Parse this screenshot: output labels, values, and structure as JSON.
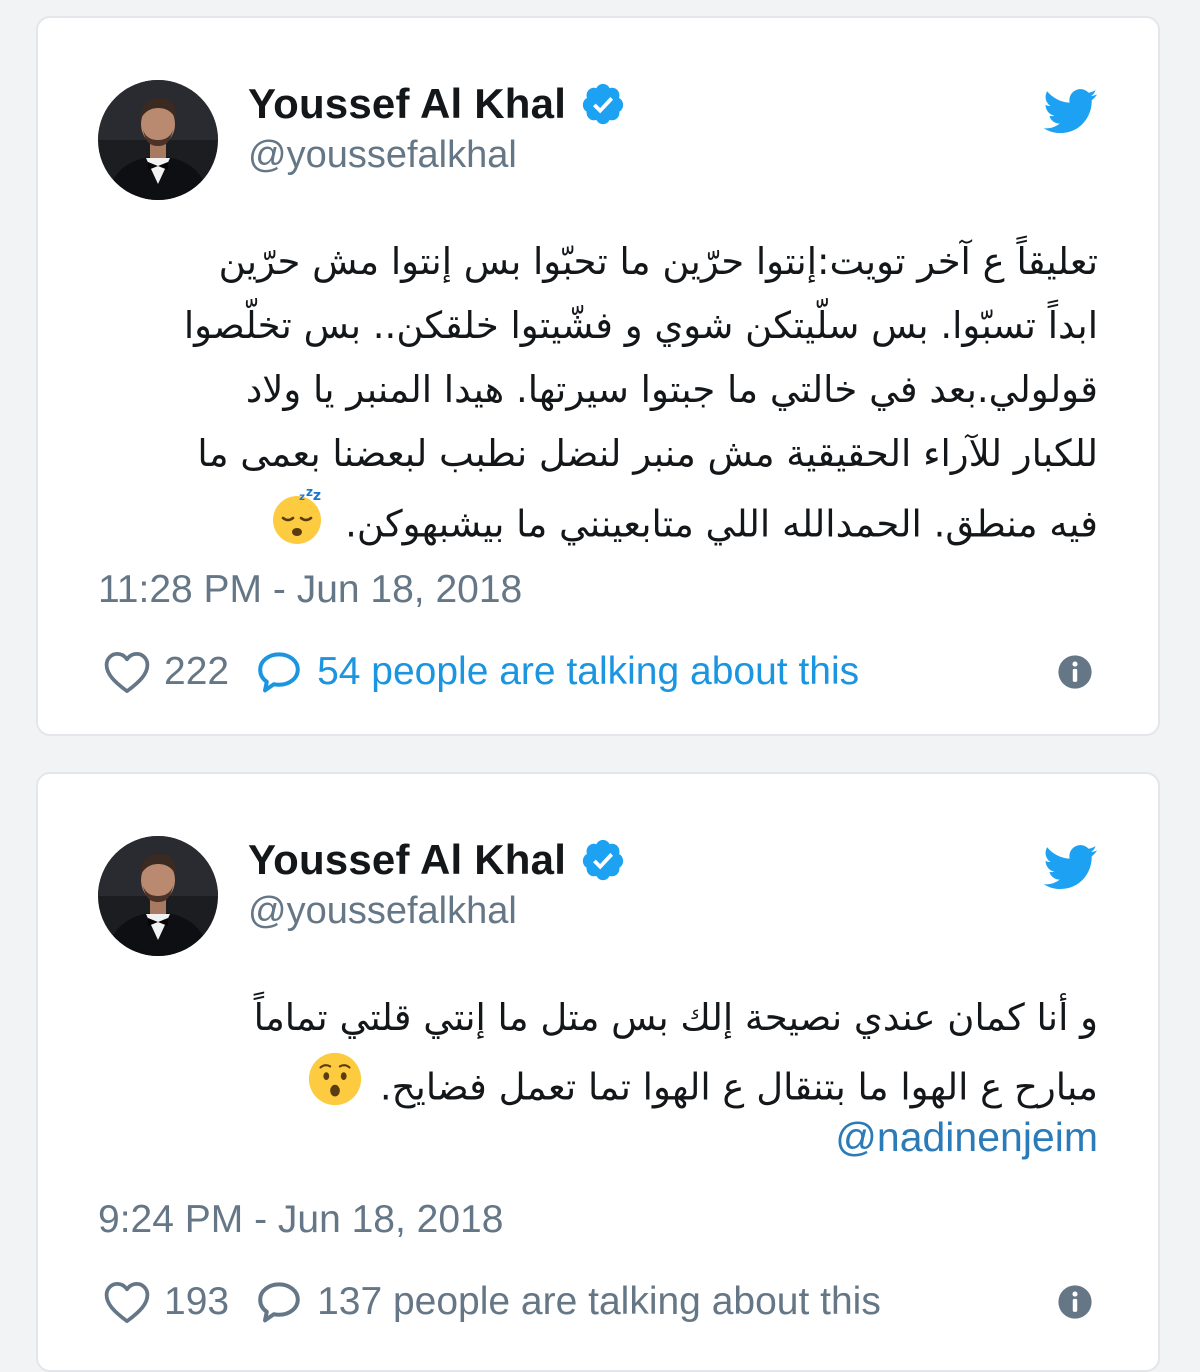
{
  "colors": {
    "twitter_blue": "#1da1f2",
    "link_blue": "#1b95e0",
    "mention_blue": "#2b7bb9",
    "gray_text": "#657786",
    "name_text": "#14171a"
  },
  "tweets": [
    {
      "author": {
        "name": "Youssef Al Khal",
        "handle": "@youssefalkhal",
        "verified_icon": "verified-badge-icon",
        "avatar": "profile-photo"
      },
      "brand_icon": "twitter-bird-icon",
      "text_lines": [
        "تعليقاً ع آخر تويت:إنتوا حرّين ما تحبّوا بس إنتوا مش حرّين",
        "ابداً تسبّوا. بس سلّيتكن شوي و فشّيتوا خلقكن.. بس تخلّصوا",
        "قولولي.بعد في خالتي ما جبتوا سيرتها. هيدا المنبر يا ولاد",
        "للكبار للآراء الحقيقية مش منبر لنضل نطبب لبعضنا بعمى ما",
        "فيه منطق. الحمدالله اللي متابعينني ما بيشبهوكن."
      ],
      "emoji": "sleeping-face-emoji",
      "mention": "",
      "timestamp": "11:28 PM - Jun 18, 2018",
      "likes": "222",
      "talking": "54 people are talking about this",
      "talking_is_link": true
    },
    {
      "author": {
        "name": "Youssef Al Khal",
        "handle": "@youssefalkhal",
        "verified_icon": "verified-badge-icon",
        "avatar": "profile-photo"
      },
      "brand_icon": "twitter-bird-icon",
      "text_lines": [
        "و أنا كمان عندي نصيحة إلك بس متل ما إنتي قلتي تماماً",
        "مبارح ع الهوا ما بتنقال ع الهوا تما تعمل فضايح."
      ],
      "emoji": "hushed-face-emoji",
      "mention": "@nadinenjeim",
      "timestamp": "9:24 PM - Jun 18, 2018",
      "likes": "193",
      "talking": "137 people are talking about this",
      "talking_is_link": false
    }
  ]
}
